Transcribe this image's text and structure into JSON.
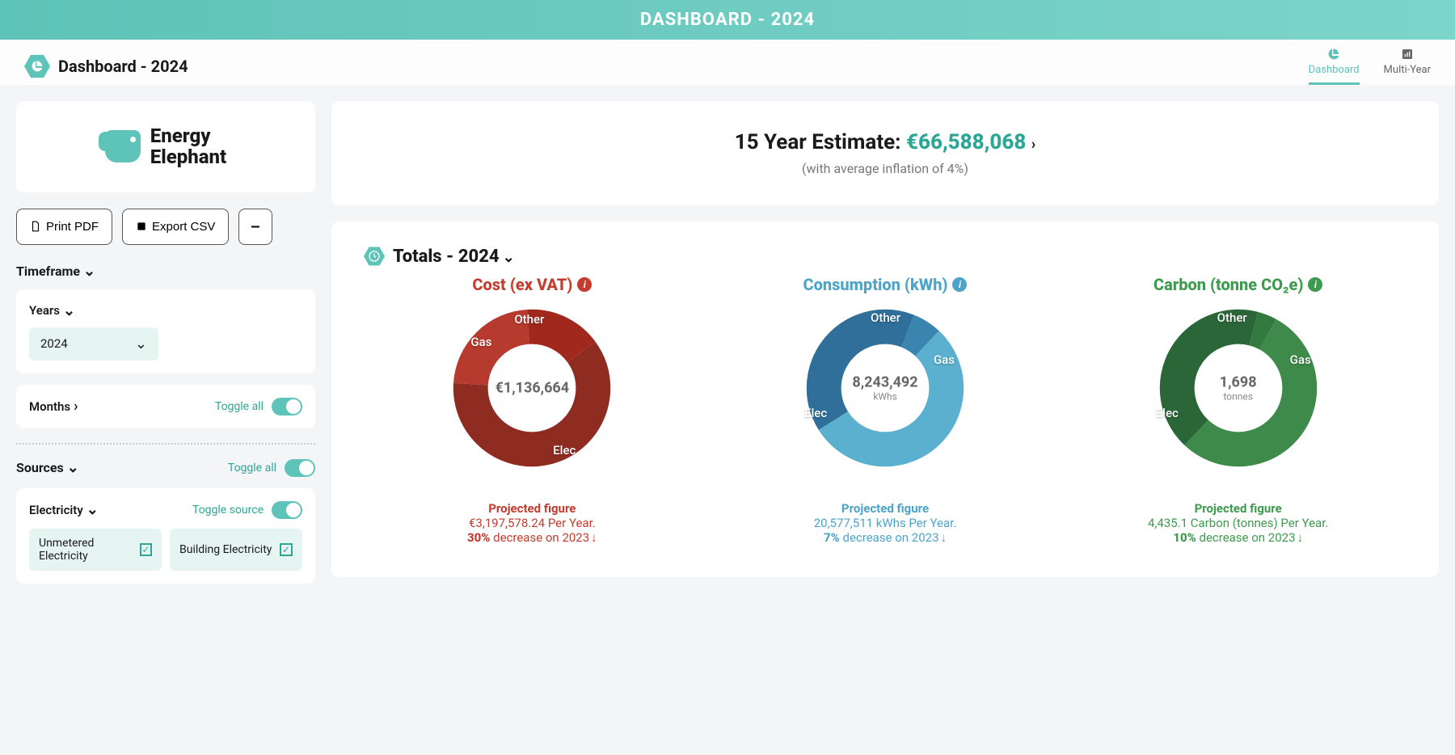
{
  "banner": "DASHBOARD - 2024",
  "header": {
    "title": "Dashboard - 2024",
    "tabs": [
      {
        "label": "Dashboard",
        "active": true
      },
      {
        "label": "Multi-Year",
        "active": false
      }
    ]
  },
  "logo": {
    "line1": "Energy",
    "line2": "Elephant"
  },
  "actions": {
    "print": "Print PDF",
    "export": "Export CSV",
    "collapse": "–"
  },
  "timeframe": {
    "label": "Timeframe",
    "years_label": "Years",
    "year_selected": "2024",
    "months_label": "Months",
    "toggle_all": "Toggle all"
  },
  "sources": {
    "label": "Sources",
    "toggle_all": "Toggle all",
    "electricity_label": "Electricity",
    "toggle_source": "Toggle source",
    "items": [
      {
        "label": "Unmetered Electricity"
      },
      {
        "label": "Building Electricity"
      }
    ]
  },
  "estimate": {
    "prefix": "15 Year Estimate: ",
    "value": "€66,588,068",
    "sub": "(with average inflation of 4%)"
  },
  "totals": {
    "title": "Totals - 2024",
    "charts": {
      "cost": {
        "heading": "Cost (ex VAT)",
        "center_value": "€1,136,664",
        "center_unit": "",
        "segments": {
          "elec": "Elec",
          "gas": "Gas",
          "other": "Other"
        },
        "projected_label": "Projected figure",
        "projected_value": "€3,197,578.24 Per Year.",
        "change_pct": "30%",
        "change_text": " decrease on 2023"
      },
      "consumption": {
        "heading": "Consumption (kWh)",
        "center_value": "8,243,492",
        "center_unit": "kWhs",
        "segments": {
          "elec": "Elec",
          "gas": "Gas",
          "other": "Other"
        },
        "projected_label": "Projected figure",
        "projected_value": "20,577,511 kWhs Per Year.",
        "change_pct": "7%",
        "change_text": " decrease on 2023"
      },
      "carbon": {
        "heading": "Carbon (tonne CO₂e)",
        "center_value": "1,698",
        "center_unit": "tonnes",
        "segments": {
          "elec": "Elec",
          "gas": "Gas",
          "other": "Other"
        },
        "projected_label": "Projected figure",
        "projected_value": "4,435.1 Carbon (tonnes) Per Year.",
        "change_pct": "10%",
        "change_text": " decrease on 2023"
      }
    }
  },
  "chart_data": [
    {
      "type": "pie",
      "title": "Cost (ex VAT)",
      "center_total": 1136664,
      "unit": "EUR",
      "series": [
        {
          "name": "Elec",
          "value": 693366,
          "pct": 61
        },
        {
          "name": "Gas",
          "value": 261432,
          "pct": 23
        },
        {
          "name": "Other",
          "value": 181866,
          "pct": 16
        }
      ]
    },
    {
      "type": "pie",
      "title": "Consumption (kWh)",
      "center_total": 8243492,
      "unit": "kWh",
      "series": [
        {
          "name": "Elec",
          "value": 4451485,
          "pct": 54
        },
        {
          "name": "Gas",
          "value": 3297397,
          "pct": 40
        },
        {
          "name": "Other",
          "value": 494610,
          "pct": 6
        }
      ]
    },
    {
      "type": "pie",
      "title": "Carbon (tonne CO2e)",
      "center_total": 1698,
      "unit": "tonnes",
      "series": [
        {
          "name": "Elec",
          "value": 917,
          "pct": 54
        },
        {
          "name": "Gas",
          "value": 713,
          "pct": 42
        },
        {
          "name": "Other",
          "value": 68,
          "pct": 4
        }
      ]
    }
  ]
}
